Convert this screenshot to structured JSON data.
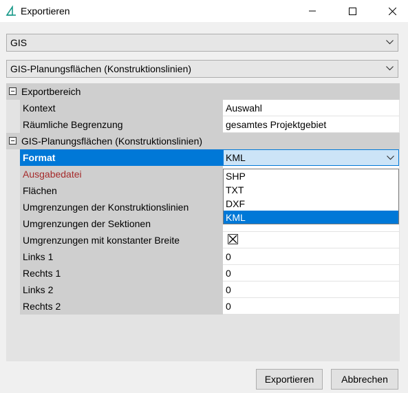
{
  "window": {
    "title": "Exportieren",
    "icons": {
      "app": "app-logo-icon",
      "minimize": "minimize-icon",
      "maximize": "maximize-icon",
      "close": "close-icon"
    }
  },
  "combos": {
    "category": "GIS",
    "type": "GIS-Planungsflächen (Konstruktionslinien)"
  },
  "grid": {
    "section1": {
      "label": "Exportbereich",
      "rows": [
        {
          "name": "Kontext",
          "value": "Auswahl"
        },
        {
          "name": "Räumliche Begrenzung",
          "value": "gesamtes Projektgebiet"
        }
      ]
    },
    "section2": {
      "label": "GIS-Planungsflächen (Konstruktionslinien)",
      "format": {
        "name": "Format",
        "value": "KML"
      },
      "output": {
        "name": "Ausgabedatei"
      },
      "flaechen": {
        "name": "Flächen"
      },
      "umgr_konst": {
        "name": "Umgrenzungen der Konstruktionslinien"
      },
      "umgr_sekt": {
        "name": "Umgrenzungen der Sektionen"
      },
      "umgr_breite": {
        "name": "Umgrenzungen mit konstanter Breite",
        "checked": true
      },
      "links1": {
        "name": "Links 1",
        "value": "0"
      },
      "rechts1": {
        "name": "Rechts 1",
        "value": "0"
      },
      "links2": {
        "name": "Links 2",
        "value": "0"
      },
      "rechts2": {
        "name": "Rechts 2",
        "value": "0"
      }
    }
  },
  "dropdown": {
    "options": [
      "SHP",
      "TXT",
      "DXF",
      "KML"
    ],
    "selected": "KML"
  },
  "buttons": {
    "export": "Exportieren",
    "cancel": "Abbrechen"
  },
  "colors": {
    "accent": "#0078d7",
    "required_label": "#a52a2a"
  }
}
